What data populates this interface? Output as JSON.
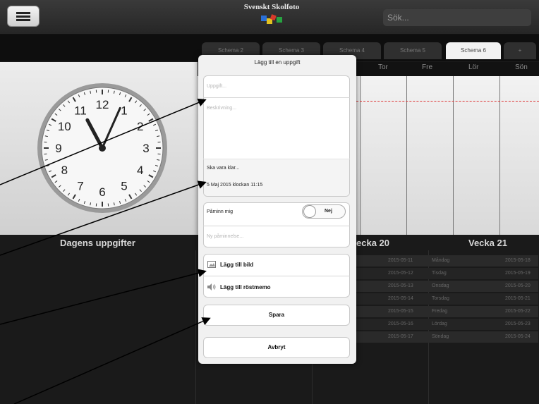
{
  "header": {
    "logo_text": "Svenskt Skolfoto",
    "search_placeholder": "Sök..."
  },
  "tabs": [
    {
      "label": "Schema 2"
    },
    {
      "label": "Schema 3"
    },
    {
      "label": "Schema 4"
    },
    {
      "label": "Schema 5"
    },
    {
      "label": "Schema 6"
    },
    {
      "label": "+"
    }
  ],
  "calendar": {
    "day_headers": [
      "Tor",
      "Fre",
      "Lör",
      "Sön"
    ]
  },
  "clock": {
    "numbers": [
      "12",
      "1",
      "2",
      "3",
      "4",
      "5",
      "6",
      "7",
      "8",
      "9",
      "10",
      "11"
    ],
    "time_hours": 11,
    "time_minutes": 4
  },
  "lower": {
    "dagens_title": "Dagens uppgifter",
    "week20_title": "ecka 20",
    "week21_title": "Vecka 21",
    "week20_dates": [
      "2015-05-11",
      "2015-05-12",
      "2015-05-13",
      "2015-05-14",
      "2015-05-15",
      "2015-05-16",
      "2015-05-17"
    ],
    "week21_days": [
      "Måndag",
      "Tisdag",
      "Onsdag",
      "Torsdag",
      "Fredag",
      "Lördag",
      "Söndag"
    ],
    "week21_dates": [
      "2015-05-18",
      "2015-05-19",
      "2015-05-20",
      "2015-05-21",
      "2015-05-22",
      "2015-05-23",
      "2015-05-24"
    ]
  },
  "dialog": {
    "title": "Lägg till en uppgift",
    "task_placeholder": "Uppgift...",
    "description_placeholder": "Beskrivning...",
    "due_label": "Ska vara klar...",
    "due_value": "5 Maj 2015 klockan 11:15",
    "remind_label": "Påminn mig",
    "remind_toggle": "Nej",
    "new_reminder_placeholder": "Ny påminnelse...",
    "add_image_label": "Lägg till bild",
    "add_voice_label": "Lägg till röstmemo",
    "save_label": "Spara",
    "cancel_label": "Avbryt"
  },
  "colors": {
    "dialog_bg": "#f1f1f1",
    "due_line": "#dd3333"
  }
}
